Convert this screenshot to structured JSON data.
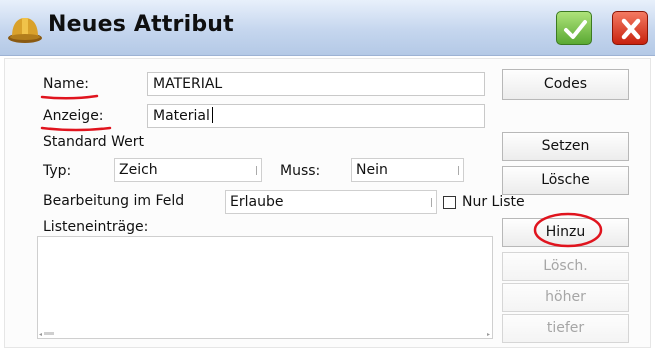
{
  "window": {
    "title": "Neues Attribut",
    "icon": "hardhat-icon",
    "ok_icon": "checkmark-icon",
    "close_icon": "close-x-icon",
    "ok_color": "#5aa933",
    "close_color": "#c8220e"
  },
  "form": {
    "name_label": "Name:",
    "name_value": "MATERIAL",
    "anzeige_label": "Anzeige:",
    "anzeige_value": "Material",
    "standard_wert_label": "Standard Wert",
    "typ_label": "Typ:",
    "typ_value": "Zeich",
    "muss_label": "Muss:",
    "muss_value": "Nein",
    "bearbeitung_label": "Bearbeitung im Feld",
    "bearbeitung_value": "Erlaube",
    "nur_liste_label": "Nur Liste",
    "nur_liste_checked": false,
    "listeneintraege_label": "Listeneinträge:",
    "list_items": []
  },
  "buttons": {
    "codes": "Codes",
    "setzen": "Setzen",
    "loesche": "Lösche",
    "hinzu": "Hinzu",
    "loesch": "Lösch.",
    "hoeher": "höher",
    "tiefer": "tiefer"
  },
  "annotations": {
    "ink_color": "#e0141e"
  }
}
